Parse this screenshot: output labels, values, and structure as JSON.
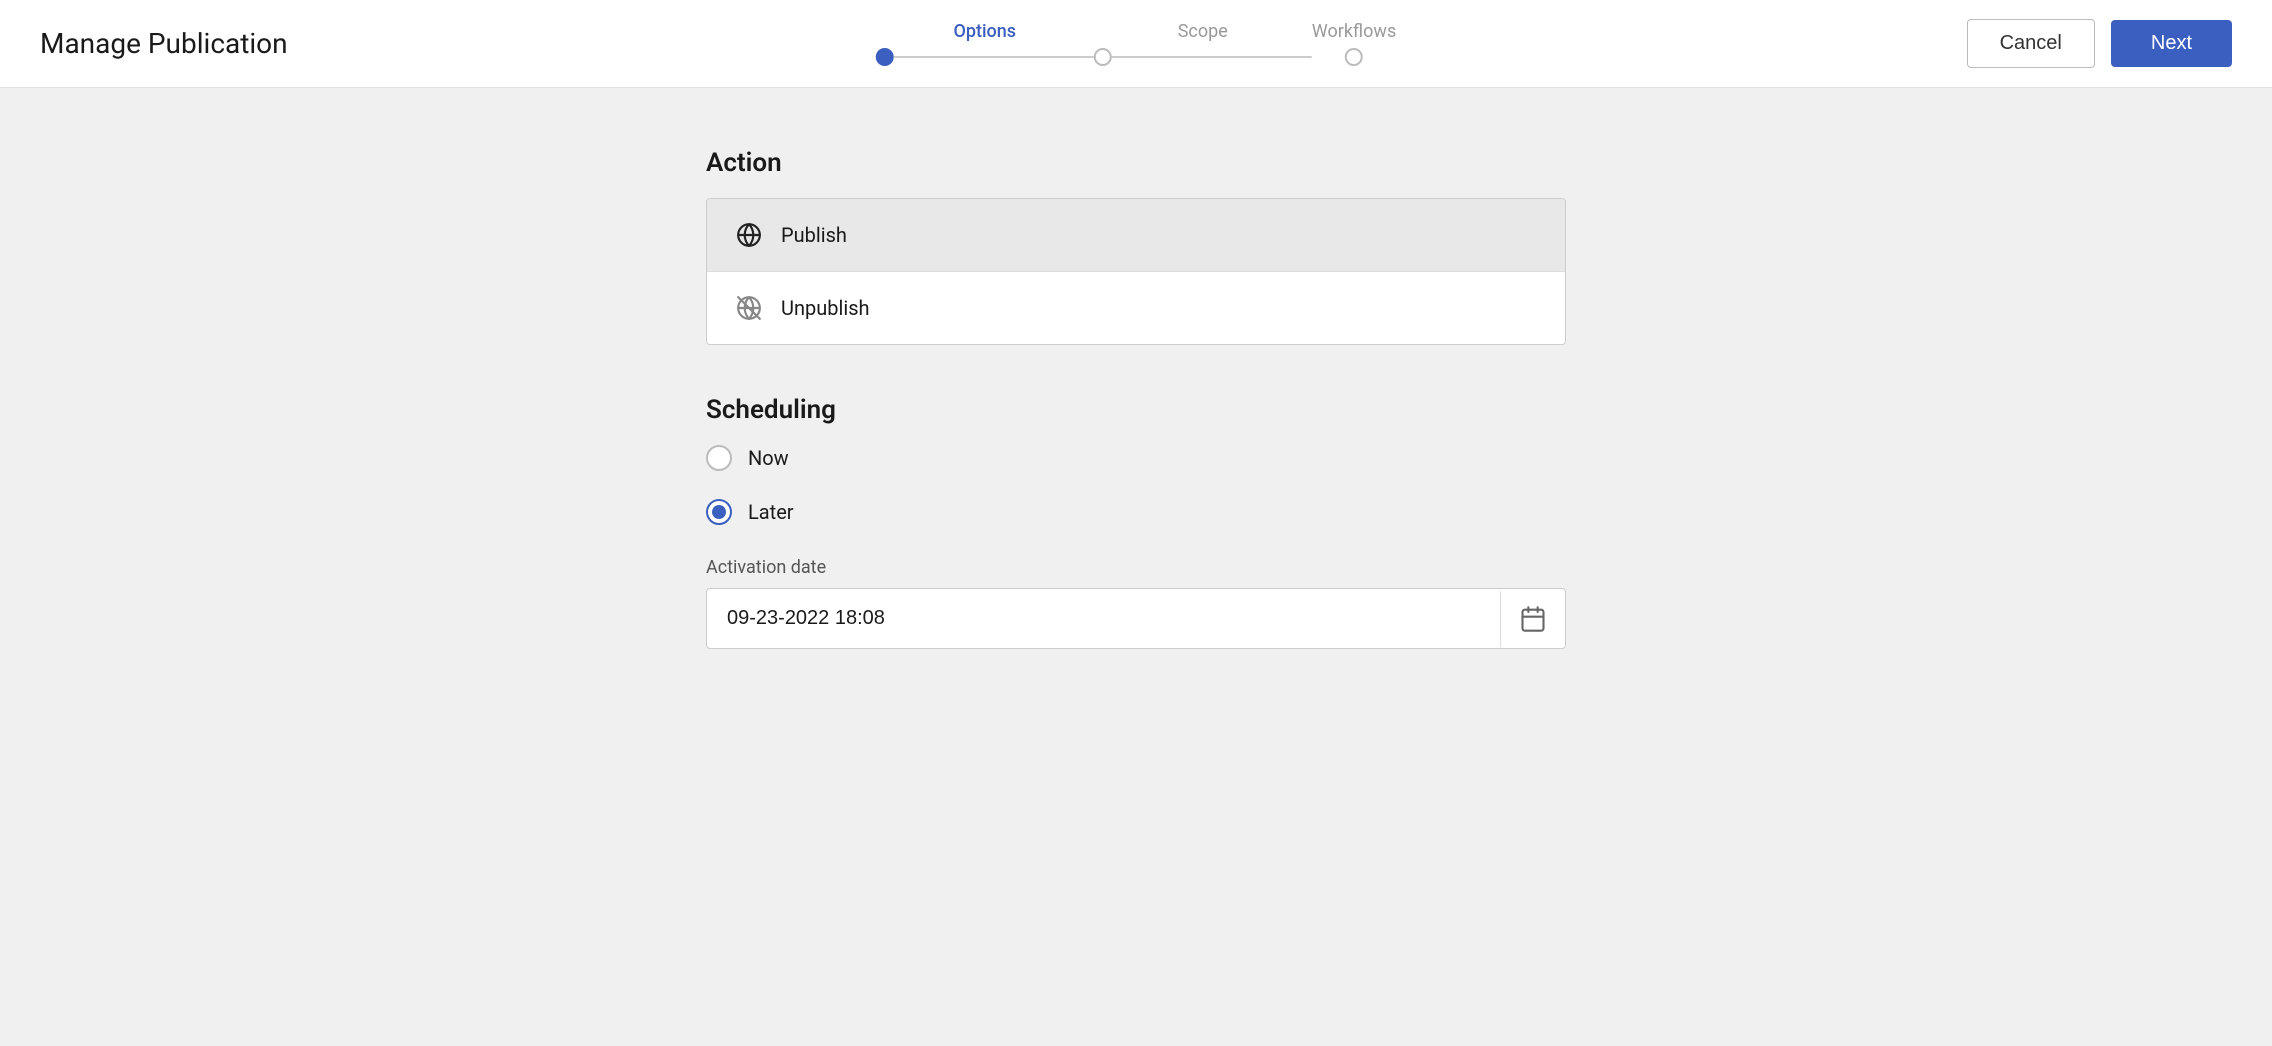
{
  "header": {
    "title": "Manage Publication",
    "cancel_label": "Cancel",
    "next_label": "Next"
  },
  "stepper": {
    "steps": [
      {
        "label": "Options",
        "state": "active"
      },
      {
        "label": "Scope",
        "state": "inactive"
      },
      {
        "label": "Workflows",
        "state": "inactive"
      }
    ]
  },
  "action_section": {
    "title": "Action",
    "items": [
      {
        "label": "Publish",
        "selected": true,
        "icon": "globe"
      },
      {
        "label": "Unpublish",
        "selected": false,
        "icon": "globe-off"
      }
    ]
  },
  "scheduling_section": {
    "title": "Scheduling",
    "options": [
      {
        "label": "Now",
        "checked": false
      },
      {
        "label": "Later",
        "checked": true
      }
    ],
    "activation_date_label": "Activation date",
    "activation_date_value": "09-23-2022 18:08"
  }
}
